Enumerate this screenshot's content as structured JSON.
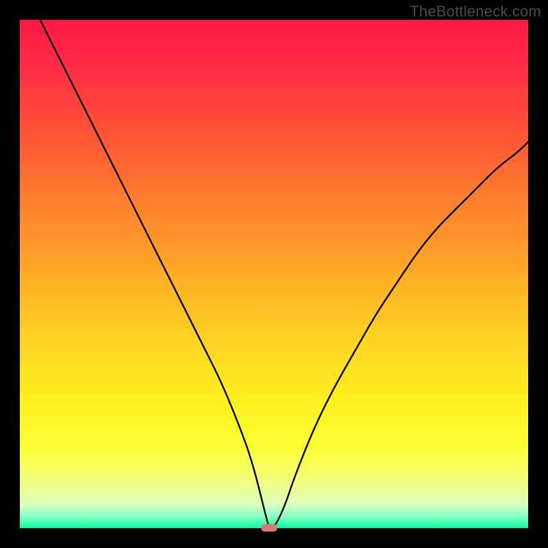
{
  "watermark": "TheBottleneck.com",
  "marker": {
    "x_pct": 49,
    "y_pct": 0,
    "color": "#d97a7a"
  },
  "chart_data": {
    "type": "line",
    "title": "",
    "xlabel": "",
    "ylabel": "",
    "xlim": [
      0,
      100
    ],
    "ylim": [
      0,
      100
    ],
    "grid": false,
    "legend": false,
    "x": [
      0,
      4,
      8,
      12,
      16,
      20,
      24,
      28,
      32,
      36,
      40,
      44,
      46,
      48,
      49,
      50,
      52,
      54,
      58,
      62,
      66,
      70,
      74,
      78,
      82,
      86,
      90,
      94,
      98,
      100
    ],
    "values": [
      108,
      100,
      92,
      84,
      76,
      68,
      60,
      52,
      44,
      36,
      28,
      18,
      12,
      4,
      0,
      0,
      4,
      10,
      20,
      28,
      35,
      42,
      48,
      54,
      59,
      63,
      67,
      71,
      74,
      76
    ],
    "annotations": []
  }
}
